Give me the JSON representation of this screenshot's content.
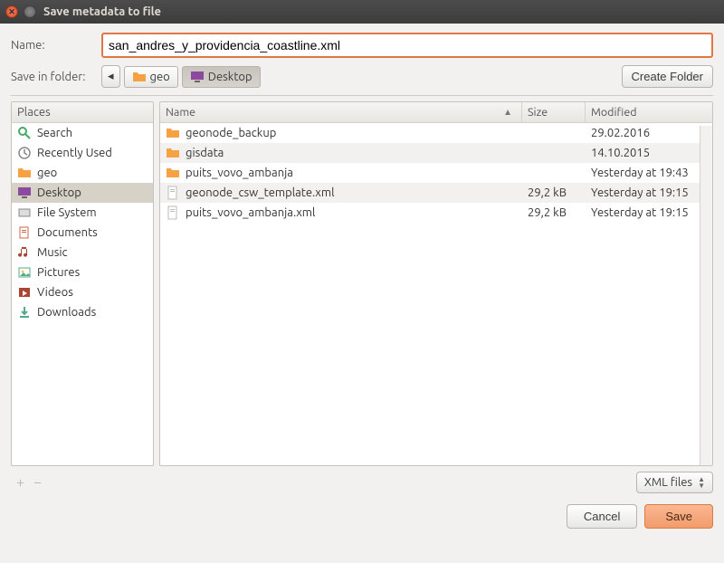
{
  "titlebar": {
    "title": "Save metadata to file"
  },
  "labels": {
    "name": "Name:",
    "save_in_folder": "Save in folder:",
    "places": "Places",
    "col_name": "Name",
    "col_size": "Size",
    "col_modified": "Modified"
  },
  "filename": {
    "value": "san_andres_y_providencia_coastline.xml"
  },
  "buttons": {
    "create_folder": "Create Folder",
    "cancel": "Cancel",
    "save": "Save",
    "back": "◂"
  },
  "breadcrumb": [
    {
      "label": "geo",
      "icon": "folder"
    },
    {
      "label": "Desktop",
      "icon": "desktop",
      "active": true
    }
  ],
  "places_list": [
    {
      "label": "Search",
      "icon": "search"
    },
    {
      "label": "Recently Used",
      "icon": "recent"
    },
    {
      "label": "geo",
      "icon": "folder"
    },
    {
      "label": "Desktop",
      "icon": "desktop",
      "selected": true
    },
    {
      "label": "File System",
      "icon": "drive"
    },
    {
      "label": "Documents",
      "icon": "documents"
    },
    {
      "label": "Music",
      "icon": "music"
    },
    {
      "label": "Pictures",
      "icon": "pictures"
    },
    {
      "label": "Videos",
      "icon": "videos"
    },
    {
      "label": "Downloads",
      "icon": "downloads"
    }
  ],
  "files": [
    {
      "name": "geonode_backup",
      "icon": "folder",
      "size": "",
      "modified": "29.02.2016"
    },
    {
      "name": "gisdata",
      "icon": "folder",
      "size": "",
      "modified": "14.10.2015"
    },
    {
      "name": "puits_vovo_ambanja",
      "icon": "folder",
      "size": "",
      "modified": "Yesterday at 19:43"
    },
    {
      "name": "geonode_csw_template.xml",
      "icon": "file",
      "size": "29,2 kB",
      "modified": "Yesterday at 19:15"
    },
    {
      "name": "puits_vovo_ambanja.xml",
      "icon": "file",
      "size": "29,2 kB",
      "modified": "Yesterday at 19:15"
    }
  ],
  "filetype": {
    "label": "XML files"
  }
}
